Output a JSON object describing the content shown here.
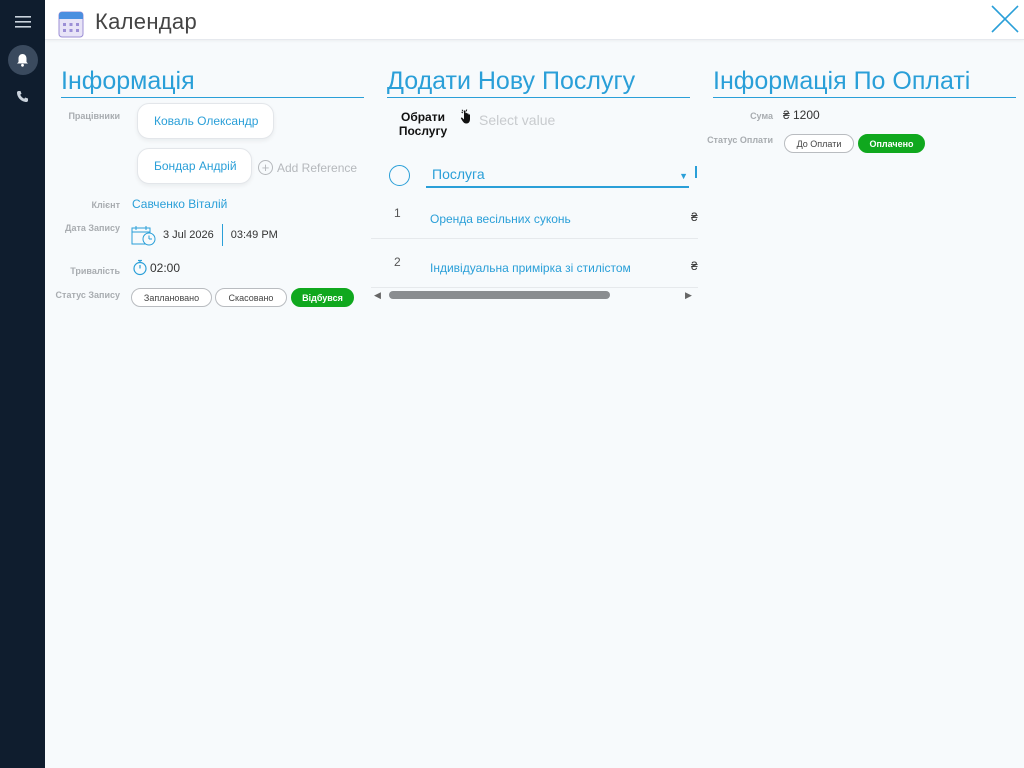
{
  "app": {
    "title": "Календар"
  },
  "info": {
    "title": "Інформація",
    "employees_label": "Працівники",
    "employees": [
      "Коваль Олександр",
      "Бондар Андрій"
    ],
    "add_reference": "Add Reference",
    "client_label": "Клієнт",
    "client": "Савченко Віталій",
    "date_label": "Дата Запису",
    "date": "3 Jul 2026",
    "time": "03:49 PM",
    "duration_label": "Тривалість",
    "duration": "02:00",
    "status_label": "Статус Запису",
    "statuses": [
      "Заплановано",
      "Скасовано",
      "Відбувся"
    ],
    "active_status": "Відбувся"
  },
  "service": {
    "title": "Додати Нову Послугу",
    "pick_label": "Обрати Послугу",
    "pick_placeholder": "Select value",
    "column": "Послуга",
    "column_more": "l",
    "rows": [
      {
        "num": "1",
        "name": "Оренда весільних суконь",
        "currency": "₴"
      },
      {
        "num": "2",
        "name": "Індивідуальна примірка зі стилістом",
        "currency": "₴"
      }
    ]
  },
  "payment": {
    "title": "Інформація По Оплаті",
    "sum_label": "Сума",
    "sum": "₴ 1200",
    "status_label": "Статус Оплати",
    "statuses": [
      "До Оплати",
      "Оплачено"
    ],
    "active_status": "Оплачено"
  },
  "icons": [
    "menu-icon",
    "bell-icon",
    "phone-icon",
    "calendar-icon",
    "close-icon",
    "calendar-clock-icon",
    "stopwatch-icon",
    "hand-pointer-icon"
  ],
  "colors": {
    "accent": "#2a9fd8",
    "success": "#10a81e",
    "rail": "#0f1d2e"
  }
}
